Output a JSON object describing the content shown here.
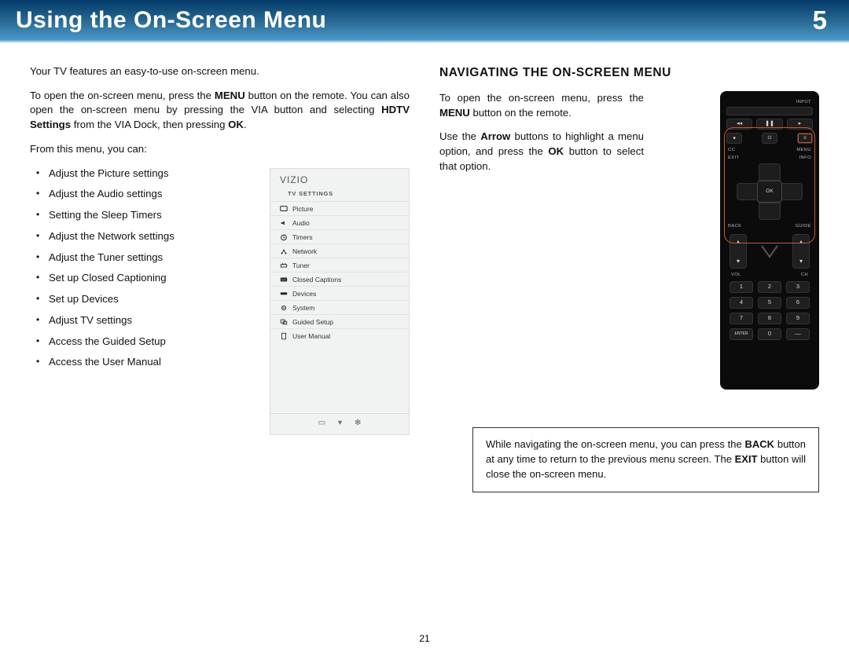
{
  "header": {
    "title": "Using the On-Screen Menu",
    "chapter": "5"
  },
  "page_number": "21",
  "left": {
    "p1": "Your TV features an easy-to-use on-screen menu.",
    "p2a": "To open the on-screen menu, press the ",
    "p2b": "MENU",
    "p2c": " button on the remote. You can also open the on-screen menu by pressing the VIA button and selecting ",
    "p2d": "HDTV Settings",
    "p2e": " from the VIA Dock, then pressing ",
    "p2f": "OK",
    "p2g": ".",
    "p3": "From this menu, you can:",
    "bullets": [
      "Adjust the Picture settings",
      "Adjust the Audio settings",
      "Setting the Sleep Timers",
      "Adjust the Network settings",
      "Adjust the Tuner settings",
      "Set up Closed Captioning",
      "Set up Devices",
      "Adjust TV settings",
      "Access the Guided Setup",
      "Access the User Manual"
    ]
  },
  "tvpanel": {
    "brand": "VIZIO",
    "heading": "TV SETTINGS",
    "items": [
      "Picture",
      "Audio",
      "Timers",
      "Network",
      "Tuner",
      "Closed Captions",
      "Devices",
      "System",
      "Guided Setup",
      "User Manual"
    ]
  },
  "right": {
    "heading": "NAVIGATING THE ON-SCREEN MENU",
    "p1a": "To open the on-screen menu, press the ",
    "p1b": "MENU",
    "p1c": " button on the remote.",
    "p2a": "Use the ",
    "p2b": "Arrow",
    "p2c": " buttons to highlight a menu option, and press the ",
    "p2d": "OK",
    "p2e": " button to select that option.",
    "note_a": "While navigating the on-screen menu, you can press the ",
    "note_b": "BACK",
    "note_c": " button at any time to return to the previous menu screen. The ",
    "note_d": "EXIT",
    "note_e": " button will close the on-screen menu."
  },
  "remote": {
    "top_label": "INPUT",
    "labels_row2": [
      "CC",
      "MENU"
    ],
    "labels_row3": [
      "EXIT",
      "INFO"
    ],
    "ok": "OK",
    "labels_row4": [
      "BACK",
      "GUIDE"
    ],
    "rocker_left": "VOL",
    "rocker_right": "CH",
    "numpad": [
      [
        "1",
        "2",
        "3"
      ],
      [
        "4",
        "5",
        "6"
      ],
      [
        "7",
        "8",
        "9"
      ],
      [
        "ENTER",
        "0",
        "—"
      ]
    ]
  }
}
